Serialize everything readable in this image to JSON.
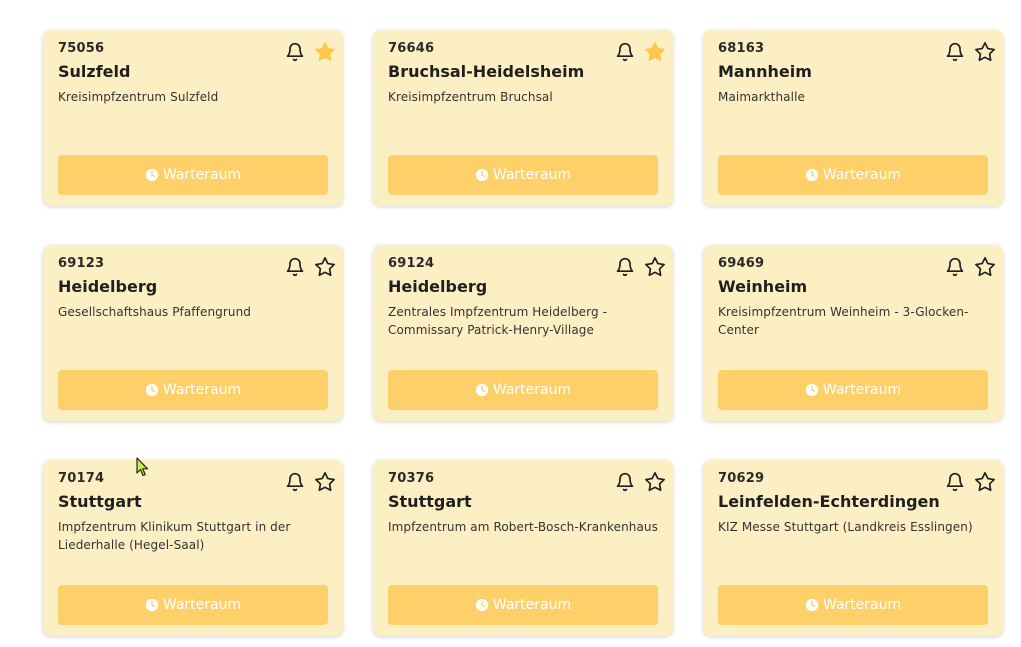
{
  "colors": {
    "card_background": "#fdefc4",
    "button_background": "#fdd06a",
    "button_text": "#ffffff",
    "star_filled": "#fdc84a",
    "icon_stroke": "#1f1f1f"
  },
  "button_label": "Warteraum",
  "button_icon": "clock-icon",
  "cards": [
    {
      "zip": "75056",
      "city": "Sulzfeld",
      "center": "Kreisimpfzentrum Sulzfeld",
      "favorite": true
    },
    {
      "zip": "76646",
      "city": "Bruchsal-Heidelsheim",
      "center": "Kreisimpfzentrum Bruchsal",
      "favorite": true
    },
    {
      "zip": "68163",
      "city": "Mannheim",
      "center": "Maimarkthalle",
      "favorite": false
    },
    {
      "zip": "69123",
      "city": "Heidelberg",
      "center": "Gesellschaftshaus Pfaffengrund",
      "favorite": false
    },
    {
      "zip": "69124",
      "city": "Heidelberg",
      "center": "Zentrales Impfzentrum Heidelberg - Commissary Patrick-Henry-Village",
      "favorite": false
    },
    {
      "zip": "69469",
      "city": "Weinheim",
      "center": "Kreisimpfzentrum Weinheim - 3-Glocken-Center",
      "favorite": false
    },
    {
      "zip": "70174",
      "city": "Stuttgart",
      "center": "Impfzentrum Klinikum Stuttgart in der Liederhalle (Hegel-Saal)",
      "favorite": false
    },
    {
      "zip": "70376",
      "city": "Stuttgart",
      "center": "Impfzentrum am Robert-Bosch-Krankenhaus",
      "favorite": false
    },
    {
      "zip": "70629",
      "city": "Leinfelden-Echterdingen",
      "center": "KIZ Messe Stuttgart (Landkreis Esslingen)",
      "favorite": false
    }
  ]
}
